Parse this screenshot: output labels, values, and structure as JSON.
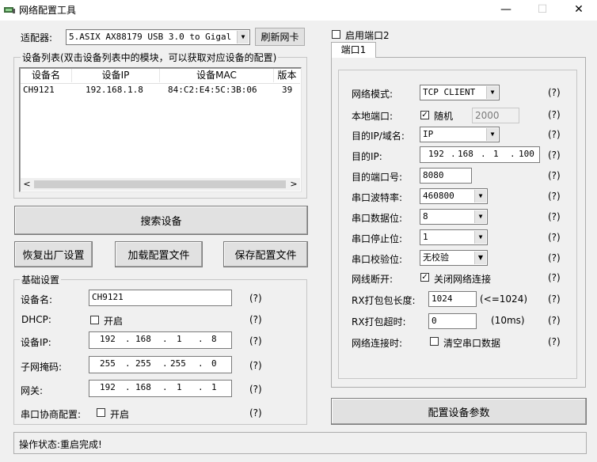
{
  "window": {
    "title": "网络配置工具",
    "minimize": "—",
    "maximize": "☐",
    "close": "✕"
  },
  "adapter": {
    "label": "适配器:",
    "value": "5.ASIX AX88179 USB 3.0 to Gigal",
    "refresh_button": "刷新网卡"
  },
  "device_list": {
    "group_title": "设备列表(双击设备列表中的模块，可以获取对应设备的配置)",
    "columns": [
      "设备名",
      "设备IP",
      "设备MAC",
      "版本"
    ],
    "rows": [
      {
        "name": "CH9121",
        "ip": "192.168.1.8",
        "mac": "84:C2:E4:5C:3B:06",
        "version": "39"
      }
    ]
  },
  "buttons": {
    "search": "搜索设备",
    "restore": "恢复出厂设置",
    "load": "加载配置文件",
    "save": "保存配置文件",
    "configure": "配置设备参数"
  },
  "basic": {
    "group_title": "基础设置",
    "device_name_label": "设备名:",
    "device_name_value": "CH9121",
    "dhcp_label": "DHCP:",
    "dhcp_option": "开启",
    "device_ip_label": "设备IP:",
    "device_ip": [
      "192",
      "168",
      "1",
      "8"
    ],
    "subnet_label": "子网掩码:",
    "subnet": [
      "255",
      "255",
      "255",
      "0"
    ],
    "gateway_label": "网关:",
    "gateway": [
      "192",
      "168",
      "1",
      "1"
    ],
    "serial_neg_label": "串口协商配置:",
    "serial_neg_option": "开启",
    "hint": "(?)"
  },
  "port": {
    "enable_port2_label": "启用端口2",
    "tab1": "端口1",
    "net_mode_label": "网络模式:",
    "net_mode_value": "TCP CLIENT",
    "local_port_label": "本地端口:",
    "random_label": "随机",
    "local_port_value": "2000",
    "dest_type_label": "目的IP/域名:",
    "dest_type_value": "IP",
    "dest_ip_label": "目的IP:",
    "dest_ip": [
      "192",
      "168",
      "1",
      "100"
    ],
    "dest_port_label": "目的端口号:",
    "dest_port_value": "8080",
    "baud_label": "串口波特率:",
    "baud_value": "460800",
    "databits_label": "串口数据位:",
    "databits_value": "8",
    "stopbits_label": "串口停止位:",
    "stopbits_value": "1",
    "parity_label": "串口校验位:",
    "parity_value": "无校验",
    "disconnect_label": "网线断开:",
    "disconnect_option": "关闭网络连接",
    "rx_len_label": "RX打包包长度:",
    "rx_len_value": "1024",
    "rx_len_note": "(<=1024)",
    "rx_timeout_label": "RX打包超时:",
    "rx_timeout_value": "0",
    "rx_timeout_note": "(10ms)",
    "net_connect_label": "网络连接时:",
    "net_connect_option": "清空串口数据",
    "hint": "(?)"
  },
  "status": {
    "text": "操作状态:重启完成!"
  }
}
